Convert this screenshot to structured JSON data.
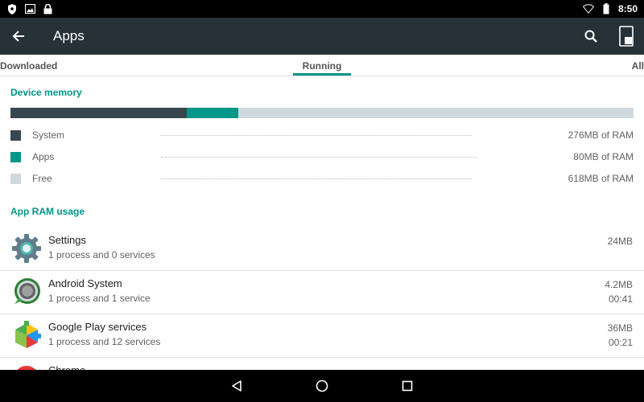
{
  "status_bar": {
    "time": "8:50",
    "left_icons": [
      "shield-icon",
      "image-icon",
      "lock-icon"
    ],
    "right_icons": [
      "wifi-icon",
      "battery-icon"
    ]
  },
  "app_bar": {
    "title": "Apps",
    "actions": [
      "search-icon",
      "device-icon"
    ]
  },
  "tabs": [
    {
      "label": "Downloaded"
    },
    {
      "label": "Running",
      "selected": true
    },
    {
      "label": "All"
    }
  ],
  "device_memory": {
    "header": "Device memory",
    "segments": [
      {
        "label": "System",
        "value": "276MB of RAM",
        "mb": 276,
        "color": "#37474f"
      },
      {
        "label": "Apps",
        "value": "80MB of RAM",
        "mb": 80,
        "color": "#009688"
      },
      {
        "label": "Free",
        "value": "618MB of RAM",
        "mb": 618,
        "color": "#cfd8dc"
      }
    ]
  },
  "app_ram": {
    "header": "App RAM usage",
    "items": [
      {
        "name": "Settings",
        "sub": "1 process and 0 services",
        "size": "24MB",
        "time": "",
        "icon": "settings-gear-icon"
      },
      {
        "name": "Android System",
        "sub": "1 process and 1 service",
        "size": "4.2MB",
        "time": "00:41",
        "icon": "android-system-icon"
      },
      {
        "name": "Google Play services",
        "sub": "1 process and 12 services",
        "size": "36MB",
        "time": "00:21",
        "icon": "google-play-services-icon"
      },
      {
        "name": "Chrome",
        "sub": "",
        "size": "",
        "time": "",
        "icon": "chrome-icon"
      }
    ]
  },
  "nav_bar": {
    "buttons": [
      "back-triangle-icon",
      "home-circle-icon",
      "recents-square-icon"
    ]
  }
}
